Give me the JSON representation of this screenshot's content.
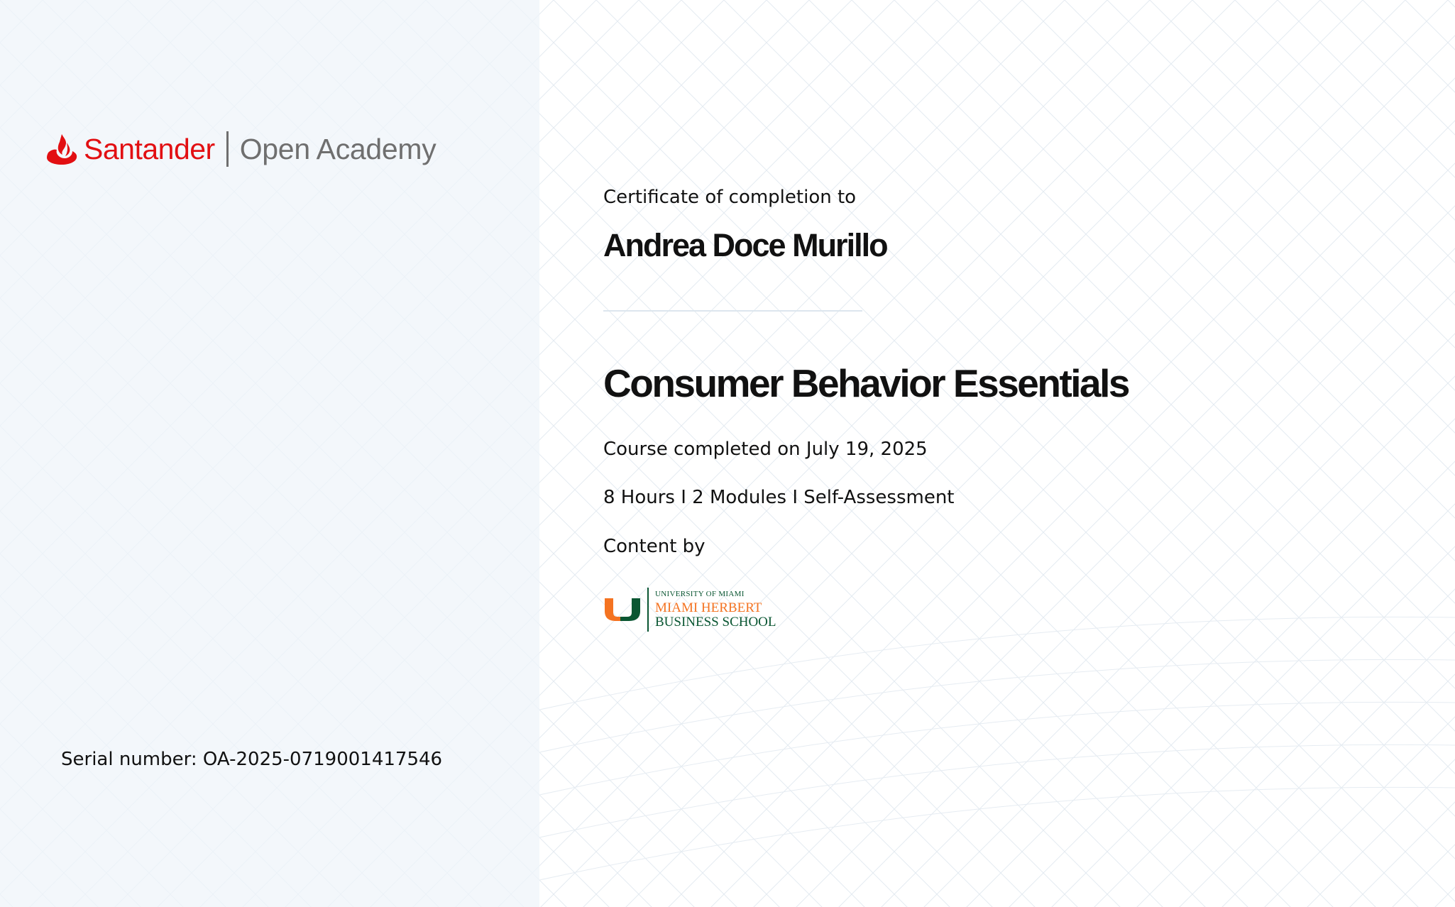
{
  "brand": {
    "name": "Santander",
    "sub": "Open Academy",
    "color": "#e20f12"
  },
  "certificate": {
    "label": "Certificate of completion to",
    "recipient": "Andrea Doce Murillo",
    "course_title": "Consumer Behavior Essentials",
    "completed": "Course completed on July 19, 2025",
    "details": "8 Hours I 2 Modules I Self-Assessment",
    "content_by_label": "Content by"
  },
  "partner": {
    "line1": "UNIVERSITY OF MIAMI",
    "line2": "MIAMI HERBERT",
    "line3": "BUSINESS SCHOOL",
    "colors": {
      "orange": "#f47321",
      "green": "#0a5632"
    }
  },
  "serial": "Serial number: OA-2025-0719001417546"
}
